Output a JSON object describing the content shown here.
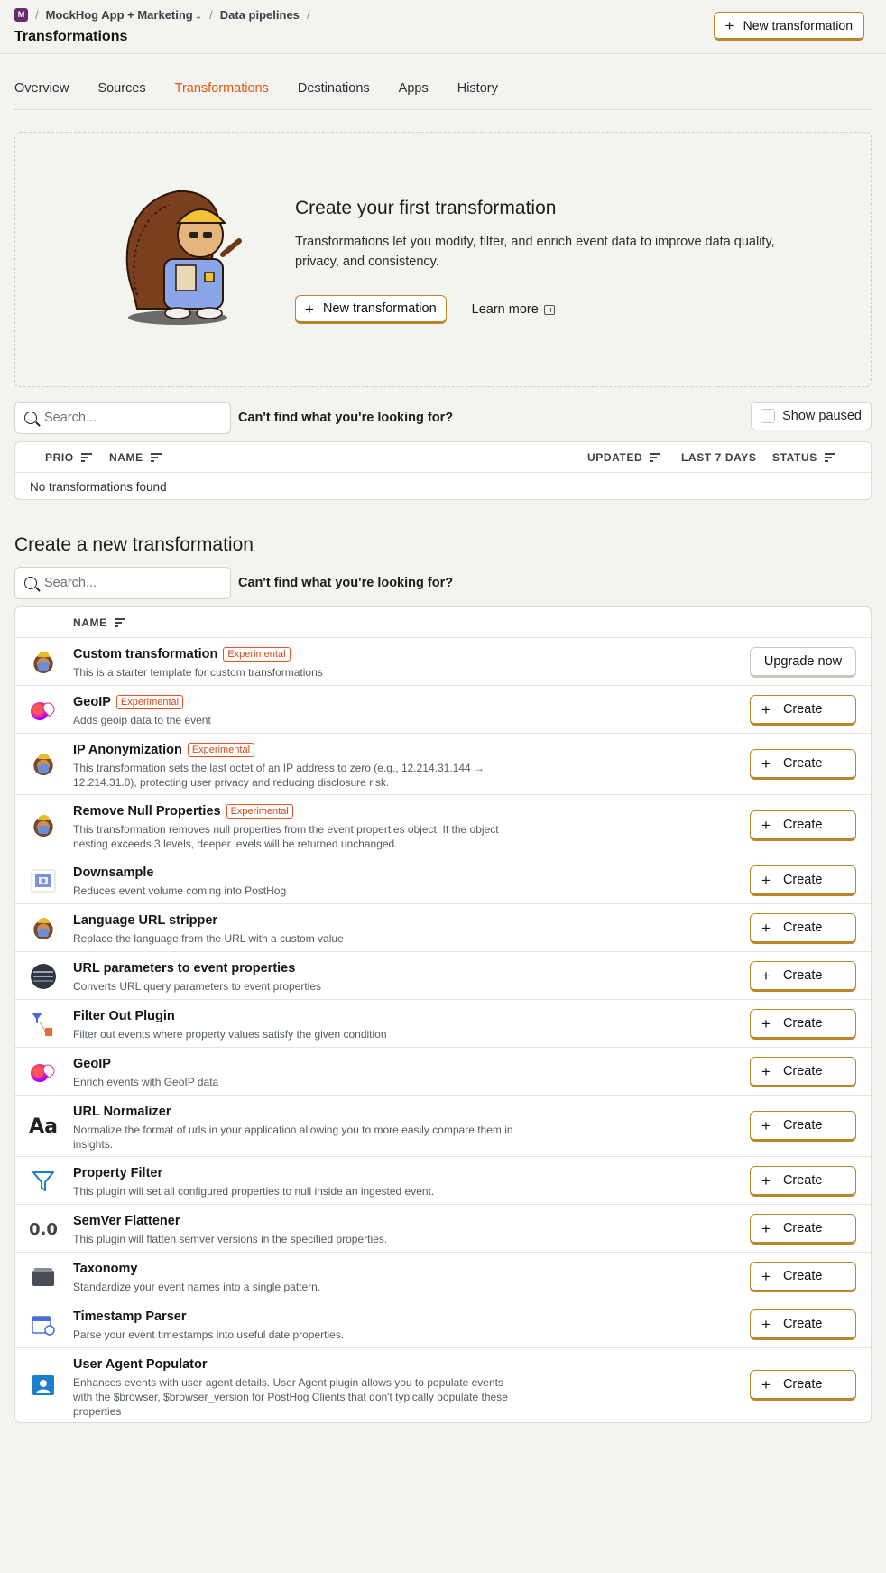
{
  "header": {
    "org_initial": "M",
    "org_name": "MockHog App + Marketing",
    "crumb_section": "Data pipelines",
    "page_title": "Transformations",
    "new_button": "New transformation"
  },
  "tabs": [
    {
      "label": "Overview"
    },
    {
      "label": "Sources"
    },
    {
      "label": "Transformations",
      "active": true
    },
    {
      "label": "Destinations"
    },
    {
      "label": "Apps"
    },
    {
      "label": "History"
    }
  ],
  "empty_state": {
    "title": "Create your first transformation",
    "description": "Transformations let you modify, filter, and enrich event data to improve data quality, privacy, and consistency.",
    "new_button": "New transformation",
    "learn_more": "Learn more"
  },
  "filters": {
    "search_placeholder": "Search...",
    "cant_find": "Can't find what you're looking for?",
    "show_paused": "Show paused"
  },
  "existing_table": {
    "columns": {
      "prio": "PRIO",
      "name": "NAME",
      "updated": "UPDATED",
      "last7": "LAST 7 DAYS",
      "status": "STATUS"
    },
    "empty_text": "No transformations found"
  },
  "create_section": {
    "title": "Create a new transformation",
    "search_placeholder": "Search...",
    "cant_find": "Can't find what you're looking for?",
    "name_column": "NAME",
    "badge_label": "Experimental",
    "items": [
      {
        "name": "Custom transformation",
        "experimental": true,
        "desc": "This is a starter template for custom transformations",
        "action": "Upgrade now",
        "icon": "hog-icon"
      },
      {
        "name": "GeoIP",
        "experimental": true,
        "desc": "Adds geoip data to the event",
        "action": "Create",
        "icon": "geoip-icon"
      },
      {
        "name": "IP Anonymization",
        "experimental": true,
        "desc": "This transformation sets the last octet of an IP address to zero (e.g., 12.214.31.144 → 12.214.31.0), protecting user privacy and reducing disclosure risk.",
        "action": "Create",
        "icon": "hog-icon"
      },
      {
        "name": "Remove Null Properties",
        "experimental": true,
        "desc": "This transformation removes null properties from the event properties object. If the object nesting exceeds 3 levels, deeper levels will be returned unchanged.",
        "action": "Create",
        "icon": "hog-icon"
      },
      {
        "name": "Downsample",
        "experimental": false,
        "desc": "Reduces event volume coming into PostHog",
        "action": "Create",
        "icon": "downsample-icon"
      },
      {
        "name": "Language URL stripper",
        "experimental": false,
        "desc": "Replace the language from the URL with a custom value",
        "action": "Create",
        "icon": "hog-icon"
      },
      {
        "name": "URL parameters to event properties",
        "experimental": false,
        "desc": "Converts URL query parameters to event properties",
        "action": "Create",
        "icon": "url-params-icon"
      },
      {
        "name": "Filter Out Plugin",
        "experimental": false,
        "desc": "Filter out events where property values satisfy the given condition",
        "action": "Create",
        "icon": "filter-out-icon"
      },
      {
        "name": "GeoIP",
        "experimental": false,
        "desc": "Enrich events with GeoIP data",
        "action": "Create",
        "icon": "geoip-icon"
      },
      {
        "name": "URL Normalizer",
        "experimental": false,
        "desc": "Normalize the format of urls in your application allowing you to more easily compare them in insights.",
        "action": "Create",
        "icon": "url-normalizer-icon",
        "icon_text": "Aa"
      },
      {
        "name": "Property Filter",
        "experimental": false,
        "desc": "This plugin will set all configured properties to null inside an ingested event.",
        "action": "Create",
        "icon": "funnel-icon"
      },
      {
        "name": "SemVer Flattener",
        "experimental": false,
        "desc": "This plugin will flatten semver versions in the specified properties.",
        "action": "Create",
        "icon": "semver-icon",
        "icon_text": "0.0"
      },
      {
        "name": "Taxonomy",
        "experimental": false,
        "desc": "Standardize your event names into a single pattern.",
        "action": "Create",
        "icon": "taxonomy-icon"
      },
      {
        "name": "Timestamp Parser",
        "experimental": false,
        "desc": "Parse your event timestamps into useful date properties.",
        "action": "Create",
        "icon": "calendar-icon"
      },
      {
        "name": "User Agent Populator",
        "experimental": false,
        "desc": "Enhances events with user agent details. User Agent plugin allows you to populate events with the $browser, $browser_version for PostHog Clients that don't typically populate these properties",
        "action": "Create",
        "icon": "user-agent-icon"
      }
    ]
  },
  "colors": {
    "accent": "#e25812",
    "button_border": "#b8862b",
    "badge": "#d24a1a",
    "background": "#f3f3ef"
  }
}
